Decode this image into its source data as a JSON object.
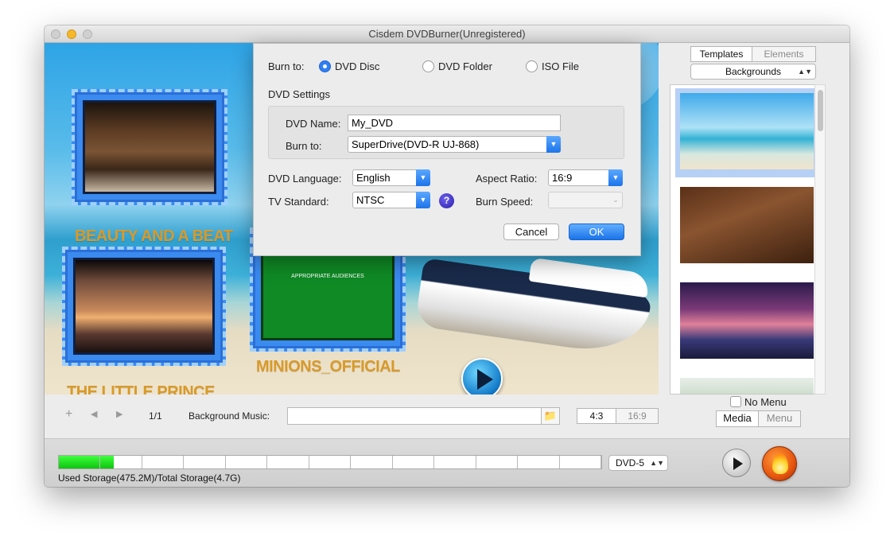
{
  "window": {
    "title": "Cisdem DVDBurner(Unregistered)"
  },
  "canvas": {
    "captions": [
      "BEAUTY AND A BEAT",
      "THE LITTLE PRINCE",
      "MINIONS_OFFICIAL"
    ],
    "stamp3_text": "APPROPRIATE AUDIENCES"
  },
  "dialog": {
    "burn_to_label": "Burn to:",
    "options": [
      "DVD Disc",
      "DVD Folder",
      "ISO File"
    ],
    "selected_option": "DVD Disc",
    "settings_title": "DVD Settings",
    "dvd_name_label": "DVD Name:",
    "dvd_name_value": "My_DVD",
    "burn_to_device_label": "Burn to:",
    "burn_to_device_value": "SuperDrive(DVD-R   UJ-868)",
    "language_label": "DVD Language:",
    "language_value": "English",
    "tv_standard_label": "TV Standard:",
    "tv_standard_value": "NTSC",
    "aspect_label": "Aspect Ratio:",
    "aspect_value": "16:9",
    "speed_label": "Burn Speed:",
    "speed_value": "",
    "help_glyph": "?",
    "cancel_label": "Cancel",
    "ok_label": "OK"
  },
  "right_panel": {
    "tabs": [
      "Templates",
      "Elements"
    ],
    "active_tab": "Templates",
    "category": "Backgrounds",
    "no_menu_label": "No Menu",
    "mode_tabs": [
      "Media",
      "Menu"
    ],
    "active_mode": "Media"
  },
  "toolbar": {
    "add_glyph": "+",
    "prev_glyph": "◀",
    "next_glyph": "▶",
    "page": "1/1",
    "music_label": "Background Music:",
    "music_value": "",
    "aspect_options": [
      "4:3",
      "16:9"
    ],
    "active_aspect": "4:3"
  },
  "status": {
    "storage_text": "Used Storage(475.2M)/Total Storage(4.7G)",
    "used_fraction": 0.101,
    "disc_type": "DVD-5"
  },
  "icons": {
    "folder": "folder-icon",
    "preview": "play-icon",
    "burn": "flame-icon"
  }
}
